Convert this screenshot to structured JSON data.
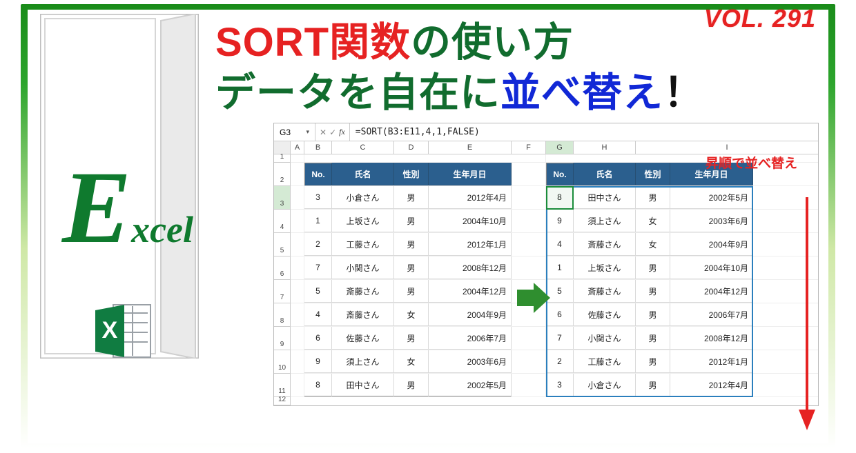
{
  "volume": "VOL. 291",
  "title": {
    "line1_red": "SORT関数",
    "line1_green": "の使い方",
    "line2_green_a": "データ",
    "line2_green_b": "を自在に",
    "line2_blue": "並べ替え",
    "line2_black": "！"
  },
  "brand": {
    "bigE": "E",
    "rest": "xcel"
  },
  "excel_icon_letter": "X",
  "formula_bar": {
    "cell_ref": "G3",
    "formula": "=SORT(B3:E11,4,1,FALSE)"
  },
  "sort_caption": "昇順で並べ替え",
  "columns": [
    "A",
    "B",
    "C",
    "D",
    "E",
    "F",
    "G",
    "H",
    "I"
  ],
  "row_numbers": [
    "1",
    "2",
    "3",
    "4",
    "5",
    "6",
    "7",
    "8",
    "9",
    "10",
    "11",
    "12"
  ],
  "headers": {
    "no": "No.",
    "name": "氏名",
    "sex": "性別",
    "dob": "生年月日"
  },
  "source_rows": [
    {
      "no": "3",
      "name": "小倉さん",
      "sex": "男",
      "dob": "2012年4月"
    },
    {
      "no": "1",
      "name": "上坂さん",
      "sex": "男",
      "dob": "2004年10月"
    },
    {
      "no": "2",
      "name": "工藤さん",
      "sex": "男",
      "dob": "2012年1月"
    },
    {
      "no": "7",
      "name": "小関さん",
      "sex": "男",
      "dob": "2008年12月"
    },
    {
      "no": "5",
      "name": "斎藤さん",
      "sex": "男",
      "dob": "2004年12月"
    },
    {
      "no": "4",
      "name": "斎藤さん",
      "sex": "女",
      "dob": "2004年9月"
    },
    {
      "no": "6",
      "name": "佐藤さん",
      "sex": "男",
      "dob": "2006年7月"
    },
    {
      "no": "9",
      "name": "須上さん",
      "sex": "女",
      "dob": "2003年6月"
    },
    {
      "no": "8",
      "name": "田中さん",
      "sex": "男",
      "dob": "2002年5月"
    }
  ],
  "result_rows": [
    {
      "no": "8",
      "name": "田中さん",
      "sex": "男",
      "dob": "2002年5月"
    },
    {
      "no": "9",
      "name": "須上さん",
      "sex": "女",
      "dob": "2003年6月"
    },
    {
      "no": "4",
      "name": "斎藤さん",
      "sex": "女",
      "dob": "2004年9月"
    },
    {
      "no": "1",
      "name": "上坂さん",
      "sex": "男",
      "dob": "2004年10月"
    },
    {
      "no": "5",
      "name": "斎藤さん",
      "sex": "男",
      "dob": "2004年12月"
    },
    {
      "no": "6",
      "name": "佐藤さん",
      "sex": "男",
      "dob": "2006年7月"
    },
    {
      "no": "7",
      "name": "小関さん",
      "sex": "男",
      "dob": "2008年12月"
    },
    {
      "no": "2",
      "name": "工藤さん",
      "sex": "男",
      "dob": "2012年1月"
    },
    {
      "no": "3",
      "name": "小倉さん",
      "sex": "男",
      "dob": "2012年4月"
    }
  ]
}
